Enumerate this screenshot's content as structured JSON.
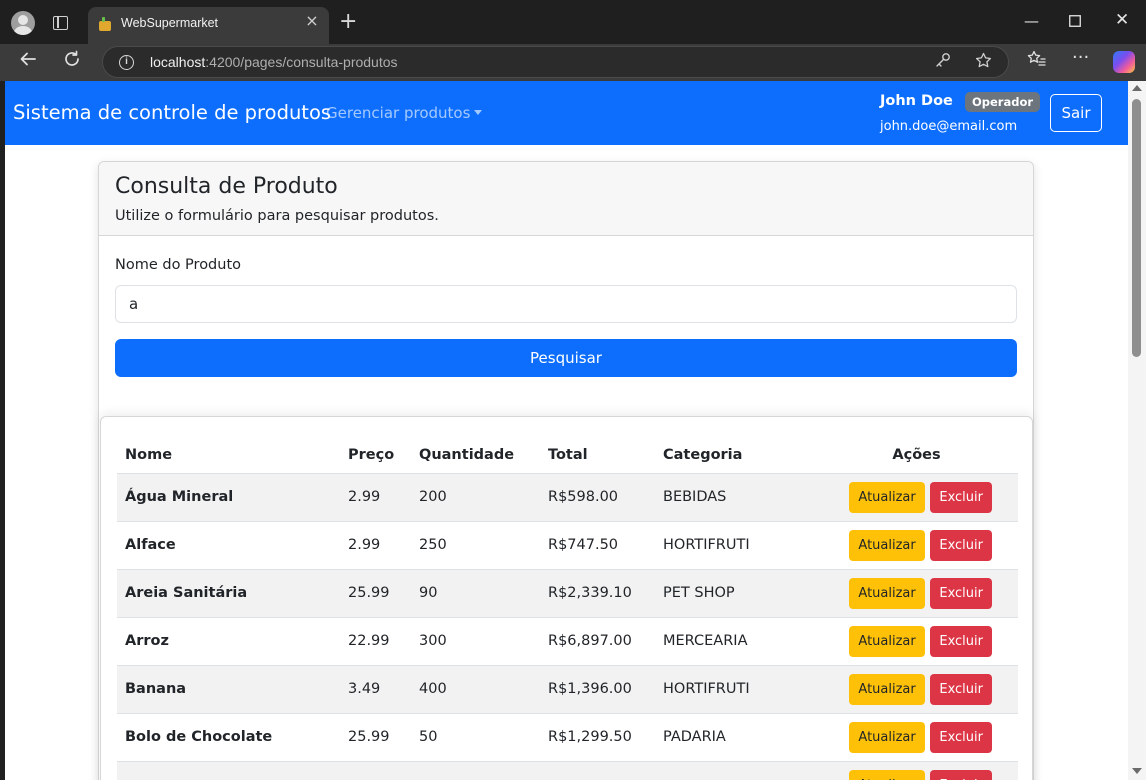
{
  "browser": {
    "tab_title": "WebSupermarket",
    "url_host": "localhost",
    "url_path": ":4200/pages/consulta-produtos",
    "colors": {
      "chrome_dark": "#1f1f1f",
      "chrome_bar": "#3b3b3b"
    }
  },
  "navbar": {
    "brand": "Sistema de controle de produtos",
    "dropdown_label": "Gerenciar produtos",
    "user_name": "John Doe",
    "user_role": "Operador",
    "user_email": "john.doe@email.com",
    "logout_label": "Sair",
    "color": "#0d6efd"
  },
  "form": {
    "title": "Consulta de Produto",
    "subtitle": "Utilize o formulário para pesquisar produtos.",
    "field_label": "Nome do Produto",
    "field_value": "a",
    "submit_label": "Pesquisar"
  },
  "table": {
    "headers": [
      "Nome",
      "Preço",
      "Quantidade",
      "Total",
      "Categoria",
      "Ações"
    ],
    "update_label": "Atualizar",
    "delete_label": "Excluir",
    "rows": [
      {
        "nome": "Água Mineral",
        "preco": "2.99",
        "quantidade": "200",
        "total": "R$598.00",
        "categoria": "BEBIDAS"
      },
      {
        "nome": "Alface",
        "preco": "2.99",
        "quantidade": "250",
        "total": "R$747.50",
        "categoria": "HORTIFRUTI"
      },
      {
        "nome": "Areia Sanitária",
        "preco": "25.99",
        "quantidade": "90",
        "total": "R$2,339.10",
        "categoria": "PET SHOP"
      },
      {
        "nome": "Arroz",
        "preco": "22.99",
        "quantidade": "300",
        "total": "R$6,897.00",
        "categoria": "MERCEARIA"
      },
      {
        "nome": "Banana",
        "preco": "3.49",
        "quantidade": "400",
        "total": "R$1,396.00",
        "categoria": "HORTIFRUTI"
      },
      {
        "nome": "Bolo de Chocolate",
        "preco": "25.99",
        "quantidade": "50",
        "total": "R$1,299.50",
        "categoria": "PADARIA"
      },
      {
        "nome": "",
        "preco": "",
        "quantidade": "",
        "total": "",
        "categoria": ""
      }
    ],
    "colors": {
      "update": "#ffc107",
      "delete": "#dc3545"
    }
  }
}
